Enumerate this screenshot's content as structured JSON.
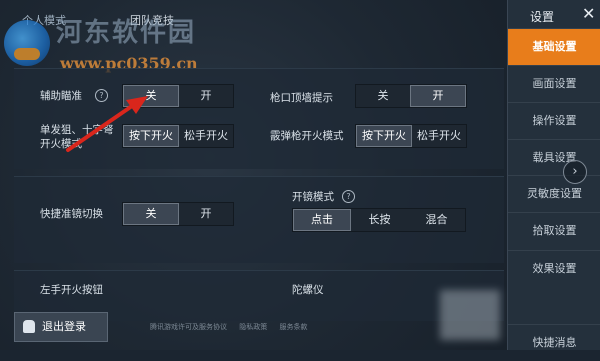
{
  "top_tabs": {
    "individual": "个人模式",
    "team": "团队竞技"
  },
  "watermark": {
    "title": "河东软件园",
    "url": "www.pc0359.cn"
  },
  "settings": {
    "aim_assist": {
      "label": "辅助瞄准",
      "off": "关",
      "on": "开",
      "selected": "off"
    },
    "wall_hint": {
      "label": "枪口顶墙提示",
      "off": "关",
      "on": "开",
      "selected": "on"
    },
    "single_shot": {
      "label": "单发狙、十字弩\n开火模式",
      "release": "按下开火",
      "loosen": "松手开火",
      "selected": "release"
    },
    "shotgun": {
      "label": "霰弹枪开火模式",
      "release": "按下开火",
      "loosen": "松手开火",
      "selected": "release"
    },
    "quick_scope": {
      "label": "快捷准镜切换",
      "off": "关",
      "on": "开",
      "selected": "off"
    },
    "scope_mode": {
      "label": "开镜模式",
      "click": "点击",
      "hold": "长按",
      "mixed": "混合",
      "selected": "click"
    },
    "left_fire": {
      "label": "左手开火按钮"
    },
    "gyro": {
      "label": "陀螺仪"
    }
  },
  "sidebar": {
    "title": "设置",
    "close": "✕",
    "items": [
      {
        "label": "基础设置",
        "active": true
      },
      {
        "label": "画面设置",
        "active": false
      },
      {
        "label": "操作设置",
        "active": false
      },
      {
        "label": "载具设置",
        "active": false
      },
      {
        "label": "灵敏度设置",
        "active": false
      },
      {
        "label": "拾取设置",
        "active": false
      },
      {
        "label": "效果设置",
        "active": false
      },
      {
        "label": "快捷消息",
        "active": false
      }
    ],
    "expand": "›"
  },
  "footer": {
    "exit_label": "退出登录",
    "links": [
      "腾讯游戏许可及服务协议",
      "隐私政策",
      "服务条款"
    ]
  },
  "colors": {
    "accent": "#e87d1b",
    "annotation_arrow": "#d9261c"
  }
}
